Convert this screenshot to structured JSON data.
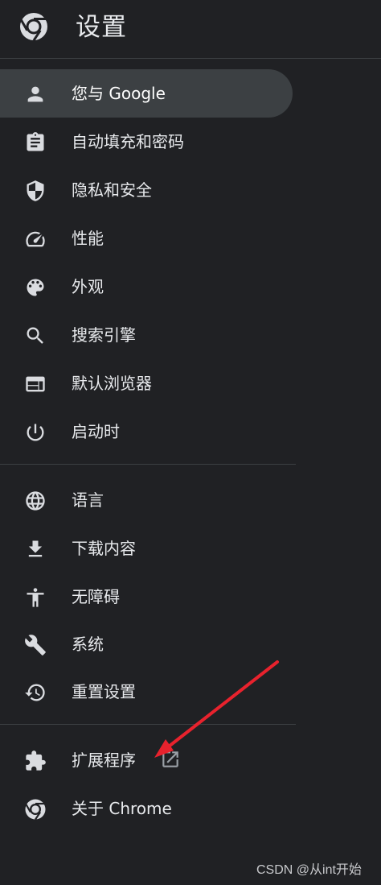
{
  "header": {
    "title": "设置",
    "logo_icon": "chrome-logo-icon"
  },
  "nav": {
    "items": [
      {
        "label": "您与 Google",
        "icon": "person-icon"
      },
      {
        "label": "自动填充和密码",
        "icon": "clipboard-icon"
      },
      {
        "label": "隐私和安全",
        "icon": "shield-icon"
      },
      {
        "label": "性能",
        "icon": "speedometer-icon"
      },
      {
        "label": "外观",
        "icon": "palette-icon"
      },
      {
        "label": "搜索引擎",
        "icon": "search-icon"
      },
      {
        "label": "默认浏览器",
        "icon": "browser-window-icon"
      },
      {
        "label": "启动时",
        "icon": "power-icon"
      },
      {
        "label": "语言",
        "icon": "globe-icon"
      },
      {
        "label": "下载内容",
        "icon": "download-icon"
      },
      {
        "label": "无障碍",
        "icon": "accessibility-icon"
      },
      {
        "label": "系统",
        "icon": "wrench-icon"
      },
      {
        "label": "重置设置",
        "icon": "history-icon"
      },
      {
        "label": "扩展程序",
        "icon": "puzzle-icon"
      },
      {
        "label": "关于 Chrome",
        "icon": "chrome-logo-icon"
      }
    ],
    "active_index": 0
  },
  "colors": {
    "background": "#202124",
    "active_bg": "#3c4043",
    "icon": "#dadce0",
    "text": "#e8eaed",
    "annotation_arrow": "#e8222d"
  },
  "watermark": "CSDN @从int开始"
}
